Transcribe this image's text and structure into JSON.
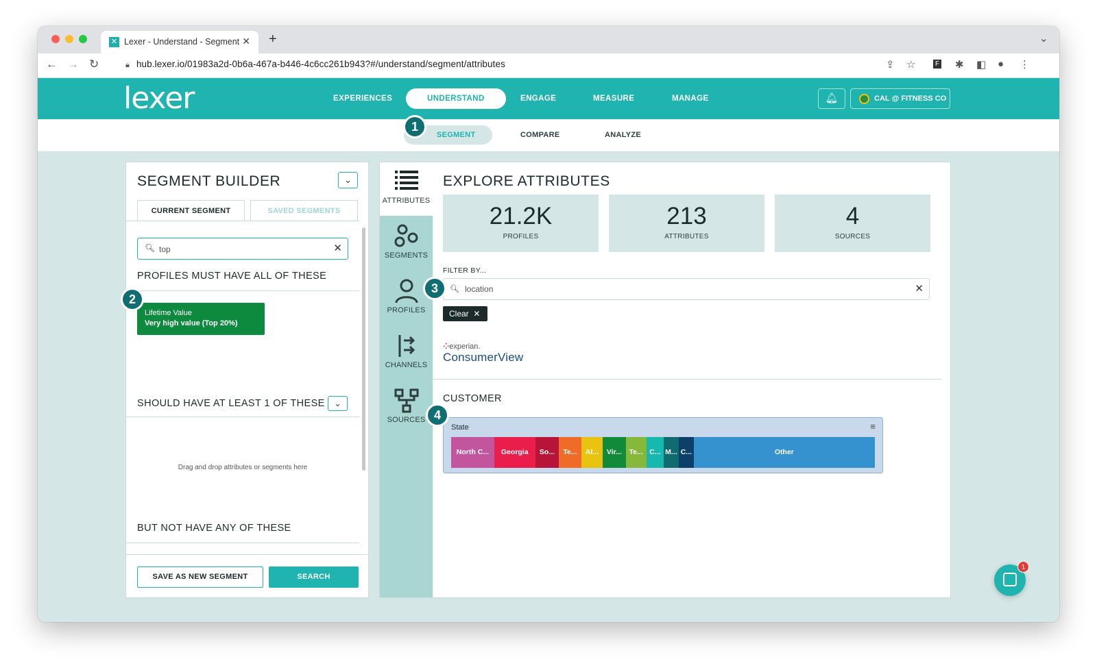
{
  "browser": {
    "tab_title": "Lexer - Understand - Segment",
    "url": "hub.lexer.io/01983a2d-0b6a-467a-b446-4c6cc261b943?#/understand/segment/attributes"
  },
  "header": {
    "logo": "lexer",
    "nav": [
      "EXPERIENCES",
      "UNDERSTAND",
      "ENGAGE",
      "MEASURE",
      "MANAGE"
    ],
    "active_nav": "UNDERSTAND",
    "account": "CAL @ FITNESS CO"
  },
  "subnav": {
    "tabs": [
      "SEGMENT",
      "COMPARE",
      "ANALYZE"
    ],
    "active": "SEGMENT"
  },
  "badges": [
    "1",
    "2",
    "3",
    "4"
  ],
  "segment_builder": {
    "title": "SEGMENT BUILDER",
    "tabs": [
      "CURRENT SEGMENT",
      "SAVED SEGMENTS"
    ],
    "search_value": "top",
    "must_have_title": "PROFILES MUST HAVE ALL OF THESE",
    "chip": {
      "label": "Lifetime Value",
      "value": "Very high value (Top 20%)"
    },
    "should_have_title": "SHOULD HAVE AT LEAST 1 OF THESE",
    "drop_hint": "Drag and drop attributes or segments here",
    "not_have_title": "BUT NOT HAVE ANY OF THESE",
    "save_button": "SAVE AS NEW SEGMENT",
    "search_button": "SEARCH"
  },
  "sidebar_icons": [
    "ATTRIBUTES",
    "SEGMENTS",
    "PROFILES",
    "CHANNELS",
    "SOURCES"
  ],
  "explore": {
    "title": "EXPLORE ATTRIBUTES",
    "stats": [
      {
        "value": "21.2K",
        "label": "PROFILES"
      },
      {
        "value": "213",
        "label": "ATTRIBUTES"
      },
      {
        "value": "4",
        "label": "SOURCES"
      }
    ],
    "filter_label": "FILTER BY...",
    "filter_value": "location",
    "clear_label": "Clear",
    "source_brand_top": "experian.",
    "source_brand_bottom": "ConsumerView",
    "category": "CUSTOMER",
    "state_card_title": "State",
    "state_segments": [
      {
        "label": "North C...",
        "color": "#c2559e",
        "share": 10
      },
      {
        "label": "Georgia",
        "color": "#e91e4a",
        "share": 9.5
      },
      {
        "label": "So...",
        "color": "#b8143a",
        "share": 5.5
      },
      {
        "label": "Te...",
        "color": "#f06a28",
        "share": 5.2
      },
      {
        "label": "Al...",
        "color": "#e8c30f",
        "share": 5
      },
      {
        "label": "Vir...",
        "color": "#118a3a",
        "share": 5.3
      },
      {
        "label": "Te...",
        "color": "#86b83a",
        "share": 4.8
      },
      {
        "label": "C...",
        "color": "#17b8b0",
        "share": 4
      },
      {
        "label": "M...",
        "color": "#0e6b70",
        "share": 3.5
      },
      {
        "label": "C...",
        "color": "#0d3f6a",
        "share": 3.5
      },
      {
        "label": "Other",
        "color": "#3592cf",
        "share": 42
      }
    ]
  },
  "chat": {
    "unread": "1"
  }
}
